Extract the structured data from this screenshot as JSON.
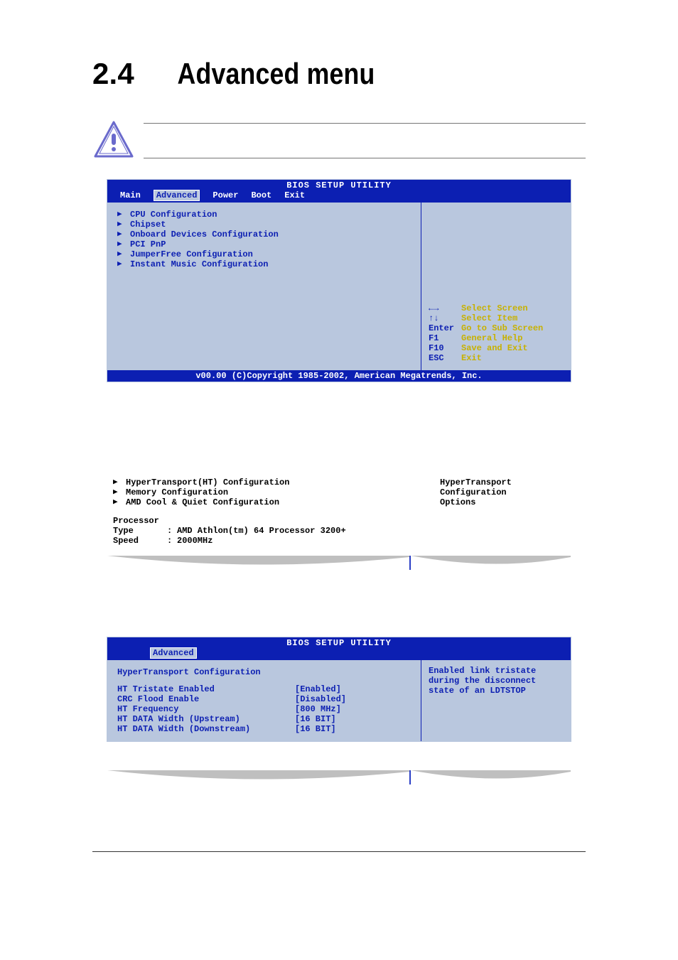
{
  "page": {
    "section_number": "2.4",
    "section_title": "Advanced menu"
  },
  "bios1": {
    "title": "BIOS SETUP UTILITY",
    "tabs": [
      "Main",
      "Advanced",
      "Power",
      "Boot",
      "Exit"
    ],
    "active_tab": "Advanced",
    "items": [
      "CPU Configuration",
      "Chipset",
      "Onboard Devices Configuration",
      "PCI PnP",
      "JumperFree Configuration",
      "Instant Music Configuration"
    ],
    "help": [
      {
        "key": "←→",
        "action": "Select Screen"
      },
      {
        "key": "↑↓",
        "action": "Select Item"
      },
      {
        "key": "Enter",
        "action": "Go to Sub Screen"
      },
      {
        "key": "F1",
        "action": "General Help"
      },
      {
        "key": "F10",
        "action": "Save and Exit"
      },
      {
        "key": "ESC",
        "action": "Exit"
      }
    ],
    "copyright": "v00.00 (C)Copyright 1985-2002, American Megatrends, Inc."
  },
  "cpu_panel": {
    "items": [
      "HyperTransport(HT) Configuration",
      "Memory Configuration",
      "AMD Cool & Quiet Configuration"
    ],
    "help_lines": [
      "HyperTransport",
      "Configuration",
      "Options"
    ],
    "proc_label": "Processor",
    "type_label": "Type",
    "type_value": "AMD Athlon(tm) 64 Processor 3200+",
    "speed_label": "Speed",
    "speed_value": "2000MHz"
  },
  "bios2": {
    "title": "BIOS SETUP UTILITY",
    "active_tab": "Advanced",
    "section_header": "HyperTransport Configuration",
    "help_lines": [
      "Enabled link tristate",
      "during the disconnect",
      "state of an LDTSTOP"
    ],
    "settings": [
      {
        "name": "HT Tristate Enabled",
        "value": "[Enabled]"
      },
      {
        "name": "CRC Flood Enable",
        "value": "[Disabled]"
      },
      {
        "name": "HT Frequency",
        "value": "[800 MHz]"
      },
      {
        "name": "HT DATA Width (Upstream)",
        "value": "[16 BIT]"
      },
      {
        "name": "HT DATA Width (Downstream)",
        "value": "[16 BIT]"
      }
    ]
  }
}
